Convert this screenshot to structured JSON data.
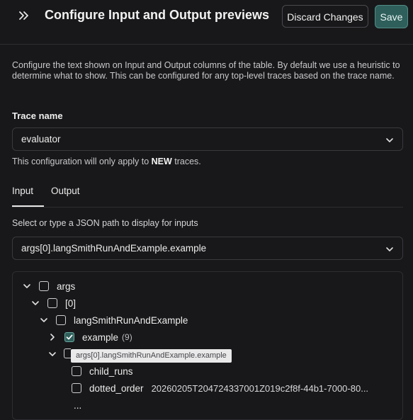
{
  "header": {
    "collapse_icon": "double-chevron-right-icon",
    "title": "Configure Input and Output previews",
    "discard_label": "Discard Changes",
    "save_label": "Save",
    "save_color": "#2f5f5b"
  },
  "description": "Configure the text shown on Input and Output columns of the table. By default we use a heuristic to determine what to show. This can be configured for any top-level traces based on the trace name.",
  "trace_name": {
    "label": "Trace name",
    "value": "evaluator"
  },
  "note": {
    "prefix": "This configuration will only apply to ",
    "emphasis": "NEW",
    "suffix": " traces."
  },
  "tabs": [
    {
      "label": "Input",
      "active": true
    },
    {
      "label": "Output",
      "active": false
    }
  ],
  "input_path": {
    "instruction": "Select or type a JSON path to display for inputs",
    "value": "args[0].langSmithRunAndExample.example"
  },
  "tree": {
    "rows": [
      {
        "label": "args",
        "expanded": true,
        "checked": false
      },
      {
        "label": "[0]",
        "expanded": true,
        "checked": false
      },
      {
        "label": "langSmithRunAndExample",
        "expanded": true,
        "checked": false
      },
      {
        "label": "example",
        "count": "(9)",
        "expanded": false,
        "checked": true
      },
      {
        "label": "child_runs",
        "checked": false
      },
      {
        "label": "dotted_order",
        "checked": false,
        "value": "20260205T204724337001Z019c2f8f-44b1-7000-80..."
      },
      {
        "label": "..."
      }
    ]
  },
  "tooltip": "args[0].langSmithRunAndExample.example"
}
